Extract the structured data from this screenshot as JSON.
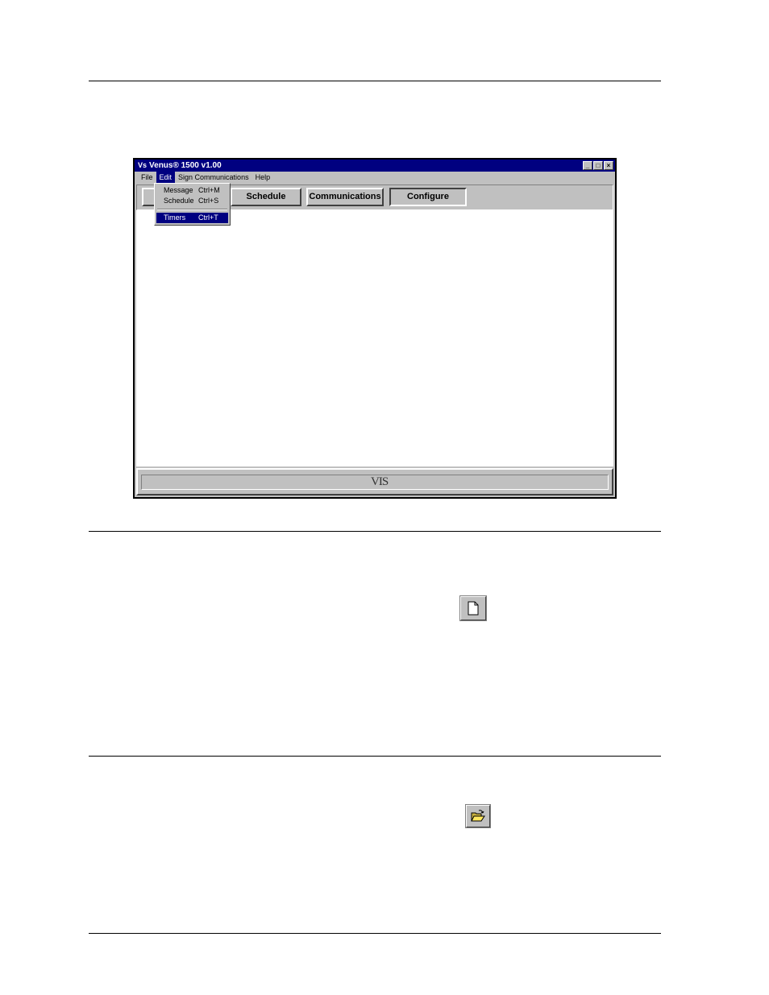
{
  "window": {
    "title": "Venus® 1500 v1.00",
    "app_icon": "Vs",
    "controls": [
      "_",
      "□",
      "×"
    ]
  },
  "menubar": {
    "items": [
      {
        "label": "File"
      },
      {
        "label": "Edit"
      },
      {
        "label": "Sign Communications"
      },
      {
        "label": "Help"
      }
    ]
  },
  "edit_menu": {
    "items": [
      {
        "label": "Message",
        "shortcut": "Ctrl+M"
      },
      {
        "label": "Schedule",
        "shortcut": "Ctrl+S"
      },
      {
        "label": "Timers",
        "shortcut": "Ctrl+T"
      }
    ]
  },
  "toolbar": {
    "schedule_label": "Schedule",
    "communications_label": "Communications",
    "configure_label": "Configure"
  },
  "statusbar": {
    "logo": "VIS"
  },
  "icons": [
    "new-file-icon",
    "open-folder-icon"
  ],
  "colors": {
    "titlebar": "#000080",
    "face": "#c0c0c0",
    "highlight": "#000080"
  }
}
